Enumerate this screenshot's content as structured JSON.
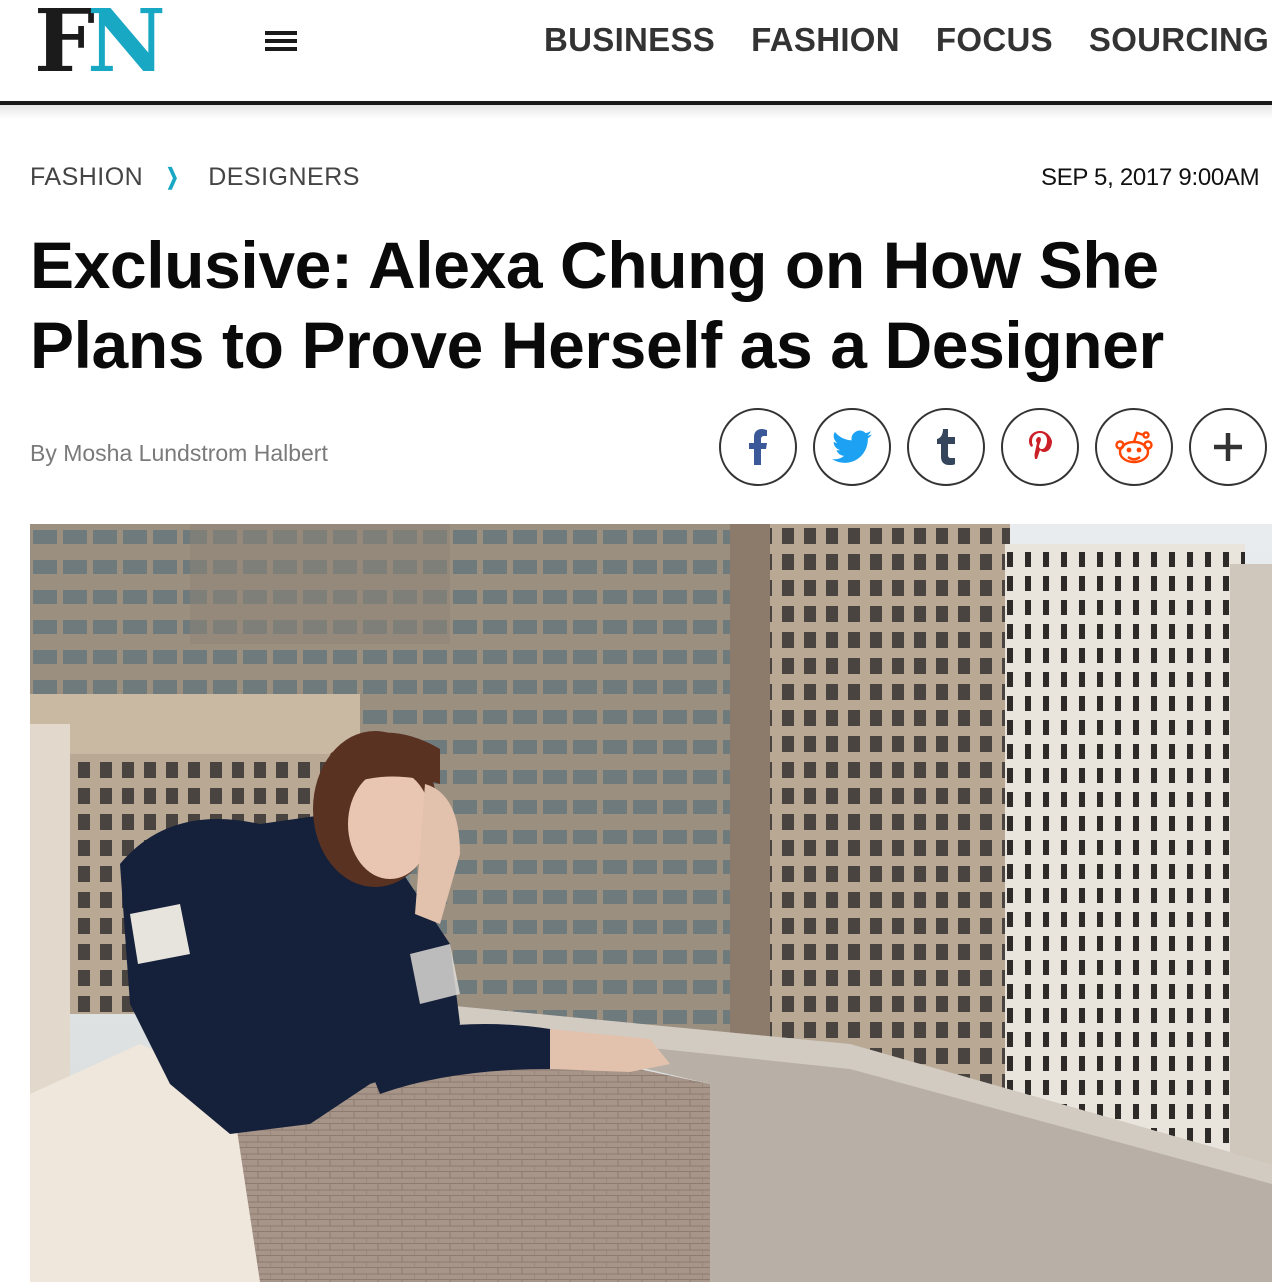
{
  "site": {
    "logo_letters": [
      "F",
      "N"
    ],
    "brand_colors": {
      "dark": "#1b1b1b",
      "accent": "#19a8c4"
    }
  },
  "nav": {
    "menu_icon": "hamburger-menu-icon",
    "items": [
      "BUSINESS",
      "FASHION",
      "FOCUS",
      "SOURCING J"
    ]
  },
  "breadcrumb": {
    "items": [
      "FASHION",
      "DESIGNERS"
    ],
    "separator_icon": "chevron-right-icon"
  },
  "article": {
    "date": "SEP 5, 2017 9:00AM",
    "title_lines": [
      "Exclusive: Alexa Chung on How She",
      "Plans to Prove Herself as a Designer"
    ],
    "byline": "By Mosha Lundstrom Halbert"
  },
  "share": {
    "buttons": [
      {
        "name": "facebook",
        "icon": "facebook-icon",
        "color": "#3b5998"
      },
      {
        "name": "twitter",
        "icon": "twitter-icon",
        "color": "#1da1f2"
      },
      {
        "name": "tumblr",
        "icon": "tumblr-icon",
        "color": "#35465c"
      },
      {
        "name": "pinterest",
        "icon": "pinterest-icon",
        "color": "#cb2027"
      },
      {
        "name": "reddit",
        "icon": "reddit-icon",
        "color": "#ff4500"
      },
      {
        "name": "more",
        "icon": "plus-icon",
        "color": "#333333"
      }
    ]
  },
  "hero": {
    "image": "hero-photo"
  }
}
